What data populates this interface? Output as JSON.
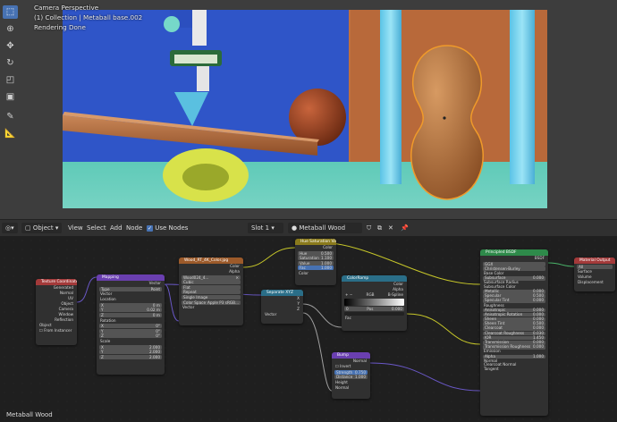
{
  "viewport": {
    "perspective_label": "Camera Perspective",
    "collection_label": "(1) Collection | Metaball base.002",
    "status_label": "Rendering Done"
  },
  "header": {
    "editor_type_icon": "node-editor-icon",
    "object_mode": "Object",
    "menu_view": "View",
    "menu_select": "Select",
    "menu_add": "Add",
    "menu_node": "Node",
    "use_nodes_label": "Use Nodes",
    "slot": "Slot 1",
    "material_name": "Metaball Wood"
  },
  "footer": {
    "material_name": "Metaball Wood"
  },
  "nodes": {
    "texcoord": {
      "title": "Texture Coordinate",
      "outputs": [
        "Generated",
        "Normal",
        "UV",
        "Object",
        "Camera",
        "Window",
        "Reflection"
      ],
      "object_label": "Object",
      "from_instancer": "From Instancer"
    },
    "mapping": {
      "title": "Mapping",
      "vector_out": "Vector",
      "type_label": "Type",
      "type_value": "Point",
      "vector_in": "Vector",
      "location": "Location",
      "loc": [
        [
          "X",
          "0 m"
        ],
        [
          "Y",
          "0.02 m"
        ],
        [
          "Z",
          "0 m"
        ]
      ],
      "rotation": "Rotation",
      "rot": [
        [
          "X",
          "0°"
        ],
        [
          "Y",
          "0°"
        ],
        [
          "Z",
          "0°"
        ]
      ],
      "scale": "Scale",
      "scl": [
        [
          "X",
          "2.000"
        ],
        [
          "Y",
          "2.000"
        ],
        [
          "Z",
          "2.000"
        ]
      ]
    },
    "image": {
      "title": "Wood_RT_4K_Color.jpg",
      "color_out": "Color",
      "alpha_out": "Alpha",
      "file": "Wood024_4...",
      "interp": "Cubic",
      "proj": "Flat",
      "ext": "Repeat",
      "source": "Single Image",
      "cs_label": "Color Space",
      "cs_value": "Apple P3 sRGB...",
      "vector_in": "Vector"
    },
    "huesat": {
      "title": "Hue Saturation Value",
      "color_out": "Color",
      "rows": [
        [
          "Hue",
          "0.500"
        ],
        [
          "Saturation",
          "1.100"
        ],
        [
          "Value",
          "1.000"
        ],
        [
          "Fac",
          "1.000"
        ]
      ],
      "color_in": "Color"
    },
    "sepxyz": {
      "title": "Separate XYZ",
      "out_x": "X",
      "out_y": "Y",
      "out_z": "Z",
      "in": "Vector"
    },
    "ramp": {
      "title": "ColorRamp",
      "color_out": "Color",
      "alpha_out": "Alpha",
      "mode": "RGB",
      "interp": "B-Spline",
      "index": "0",
      "pos_label": "Pos",
      "pos_value": "0.000",
      "fac_in": "Fac"
    },
    "bump": {
      "title": "Bump",
      "normal_out": "Normal",
      "invert": "Invert",
      "rows": [
        [
          "Strength",
          "0.750"
        ],
        [
          "Distance",
          "1.000"
        ]
      ],
      "height_in": "Height",
      "normal_in": "Normal"
    },
    "bsdf": {
      "title": "Principled BSDF",
      "bsdf_out": "BSDF",
      "dist": "GGX",
      "ss_method": "Christensen-Burley",
      "inputs": [
        [
          "Base Color",
          ""
        ],
        [
          "Subsurface",
          "0.000"
        ],
        [
          "Subsurface Radius",
          ""
        ],
        [
          "Subsurface Color",
          ""
        ],
        [
          "Metallic",
          "0.000"
        ],
        [
          "Specular",
          "0.500"
        ],
        [
          "Specular Tint",
          "0.000"
        ],
        [
          "Roughness",
          ""
        ],
        [
          "Anisotropic",
          "0.000"
        ],
        [
          "Anisotropic Rotation",
          "0.000"
        ],
        [
          "Sheen",
          "0.000"
        ],
        [
          "Sheen Tint",
          "0.500"
        ],
        [
          "Clearcoat",
          "0.000"
        ],
        [
          "Clearcoat Roughness",
          "0.030"
        ],
        [
          "IOR",
          "1.450"
        ],
        [
          "Transmission",
          "0.000"
        ],
        [
          "Transmission Roughness",
          "0.000"
        ],
        [
          "Emission",
          ""
        ],
        [
          "Alpha",
          "1.000"
        ],
        [
          "Normal",
          ""
        ],
        [
          "Clearcoat Normal",
          ""
        ],
        [
          "Tangent",
          ""
        ]
      ]
    },
    "output": {
      "title": "Material Output",
      "target": "All",
      "inputs": [
        "Surface",
        "Volume",
        "Displacement"
      ]
    }
  },
  "colors": {
    "accent": "#4772b3",
    "sky": "#2f55c8",
    "ground": "#63c9b8",
    "wood": "#b06a3c",
    "selection": "#e89a30"
  }
}
